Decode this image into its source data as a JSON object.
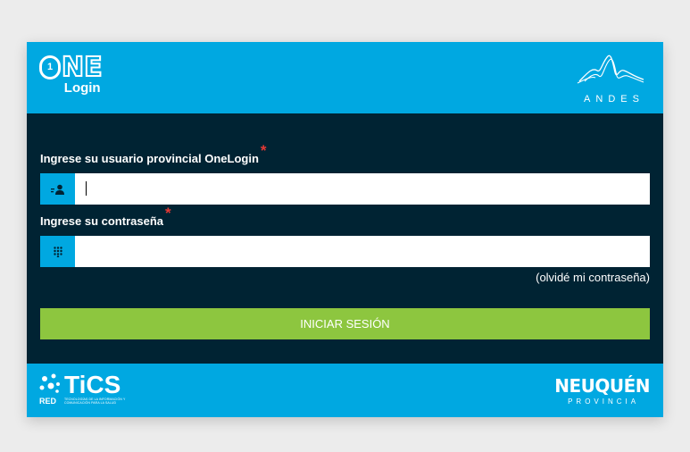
{
  "header": {
    "logo_one": "NE",
    "logo_one_digit": "1",
    "logo_login": "Login",
    "logo_andes": "ANDES"
  },
  "form": {
    "username_label": "Ingrese su usuario provincial OneLogin",
    "username_required": "*",
    "username_value": "",
    "username_icon": "user-icon",
    "password_label": "Ingrese su contraseña",
    "password_required": "*",
    "password_value": "",
    "password_icon": "keypad-icon",
    "forgot_link": "(olvidé mi contraseña)",
    "submit_label": "INICIAR SESIÓN"
  },
  "footer": {
    "red_label": "RED",
    "tics_label": "TiCS",
    "tics_subtitle": "TECNOLOGÍAS DE LA INFORMACIÓN Y COMUNICACIÓN PARA LA SALUD",
    "province_name": "NEUQUÉN",
    "province_sub": "PROVINCIA"
  },
  "colors": {
    "brand_blue": "#00a8e1",
    "dark_navy": "#002333",
    "submit_green": "#8dc63f",
    "required_red": "#e53935"
  }
}
